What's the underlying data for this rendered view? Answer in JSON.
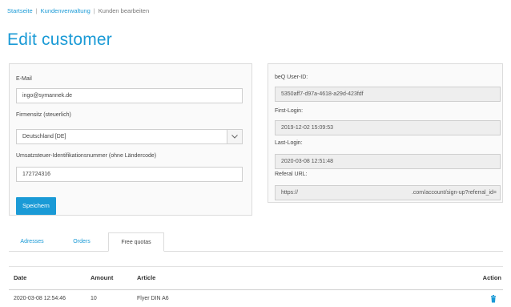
{
  "breadcrumb": {
    "home": "Startseite",
    "customers": "Kundenverwaltung",
    "current": "Kunden bearbeiten",
    "separator": "|"
  },
  "page": {
    "title": "Edit customer"
  },
  "form": {
    "email_label": "E-Mail",
    "email_value": "ingo@symannek.de",
    "company_seat_label": "Firmensitz (steuerlich)",
    "company_seat_value": "Deutschland [DE]",
    "vat_label": "Umsatzsteuer-Identifikationsnummer (ohne Ländercode)",
    "vat_value": "172724316",
    "save_label": "Speichern"
  },
  "info": {
    "user_id_label": "beQ User-ID:",
    "user_id_value": "5350aff7-d97a-4618-a29d-423fdf",
    "first_login_label": "First-Login:",
    "first_login_value": "2019-12-02 15:09:53",
    "last_login_label": "Last-Login:",
    "last_login_value": "2020-03-08 12:51:48",
    "referral_label": "Referal URL:",
    "referral_value_start": "https://",
    "referral_value_end": ".com/account/sign-up?referral_id="
  },
  "tabs": [
    {
      "label": "Adresses",
      "active": false
    },
    {
      "label": "Orders",
      "active": false
    },
    {
      "label": "Free quotas",
      "active": true
    }
  ],
  "table": {
    "headers": {
      "date": "Date",
      "amount": "Amount",
      "article": "Article",
      "action": "Action"
    },
    "rows": [
      {
        "date": "2020-03-08 12:54:46",
        "amount": "10",
        "article": "Flyer DIN A6",
        "action_icon": "trash-icon"
      }
    ]
  },
  "colors": {
    "accent": "#1a9ad6",
    "panel_bg": "#fafafa",
    "readonly_bg": "#eeeeee"
  }
}
